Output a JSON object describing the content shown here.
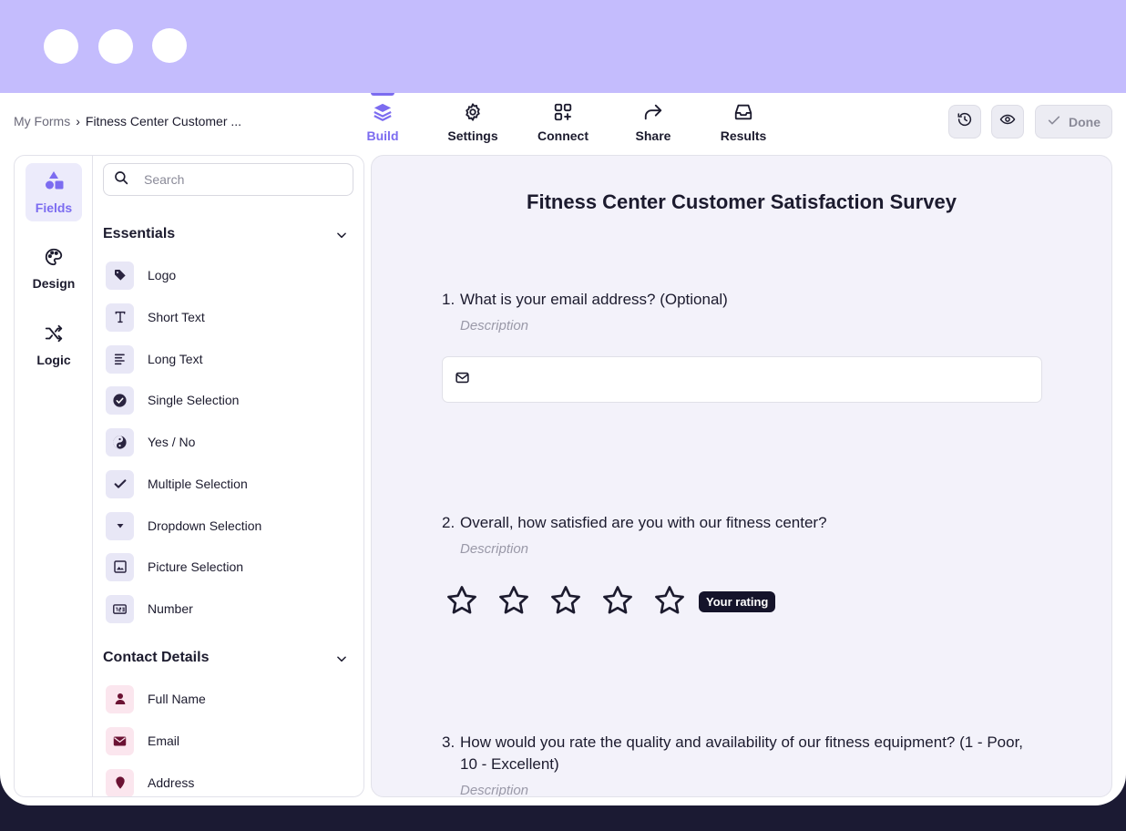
{
  "breadcrumb": {
    "root": "My Forms",
    "separator": "›",
    "current": "Fitness Center Customer ..."
  },
  "tabs": [
    {
      "label": "Build",
      "icon": "layers-icon"
    },
    {
      "label": "Settings",
      "icon": "gear-icon"
    },
    {
      "label": "Connect",
      "icon": "apps-plus-icon"
    },
    {
      "label": "Share",
      "icon": "share-arrow-icon"
    },
    {
      "label": "Results",
      "icon": "inbox-icon"
    }
  ],
  "actions": {
    "history_icon": "history-icon",
    "preview_icon": "eye-icon",
    "done_label": "Done"
  },
  "rail": [
    {
      "label": "Fields",
      "icon": "shapes-icon"
    },
    {
      "label": "Design",
      "icon": "palette-icon"
    },
    {
      "label": "Logic",
      "icon": "shuffle-icon"
    }
  ],
  "search": {
    "placeholder": "Search"
  },
  "sections": {
    "essentials": {
      "title": "Essentials",
      "items": [
        {
          "label": "Logo",
          "icon": "tag-icon"
        },
        {
          "label": "Short Text",
          "icon": "text-t-icon"
        },
        {
          "label": "Long Text",
          "icon": "align-left-icon"
        },
        {
          "label": "Single Selection",
          "icon": "check-circle-icon"
        },
        {
          "label": "Yes / No",
          "icon": "yin-yang-icon"
        },
        {
          "label": "Multiple Selection",
          "icon": "checkmark-icon"
        },
        {
          "label": "Dropdown Selection",
          "icon": "caret-down-icon"
        },
        {
          "label": "Picture Selection",
          "icon": "image-icon"
        },
        {
          "label": "Number",
          "icon": "number-box-icon"
        }
      ]
    },
    "contact": {
      "title": "Contact Details",
      "items": [
        {
          "label": "Full Name",
          "icon": "person-icon"
        },
        {
          "label": "Email",
          "icon": "envelope-icon"
        },
        {
          "label": "Address",
          "icon": "map-pin-icon"
        }
      ]
    }
  },
  "form": {
    "title": "Fitness Center Customer Satisfaction Survey",
    "questions": [
      {
        "number": "1.",
        "text": "What is your email address? (Optional)",
        "description": "Description"
      },
      {
        "number": "2.",
        "text": "Overall, how satisfied are you with our fitness center?",
        "description": "Description",
        "rating_max": 5,
        "rating_value": 0,
        "rating_tip": "Your rating"
      },
      {
        "number": "3.",
        "text": "How would you rate the quality and availability of our fitness equipment? (1 - Poor,",
        "text2": "10 - Excellent)",
        "description": "Description"
      }
    ]
  },
  "colors": {
    "accent": "#7c6cf0",
    "titlebar": "#c4bcfd",
    "field_icon": "#2a2440",
    "contact_icon": "#6b1233"
  }
}
